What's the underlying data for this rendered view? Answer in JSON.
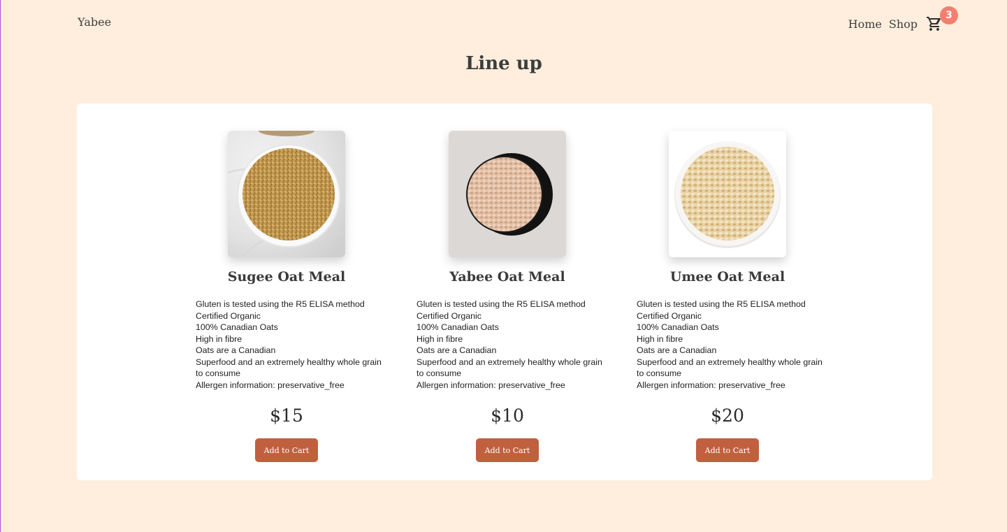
{
  "nav": {
    "brand": "Yabee",
    "links": [
      "Home",
      "Shop"
    ],
    "cart_count": "3"
  },
  "page_title": "Line up",
  "products": [
    {
      "name": "Sugee Oat Meal",
      "description": [
        "Gluten is tested using the R5 ELISA method",
        "Certified Organic",
        "100% Canadian Oats",
        "High in fibre",
        "Oats are a Canadian",
        "Superfood and an extremely healthy whole grain",
        "to consume",
        "Allergen information: preservative_free"
      ],
      "price": "$15",
      "button_label": "Add to Cart",
      "image": "steel-cut-oats-in-bowl"
    },
    {
      "name": "Yabee Oat Meal",
      "description": [
        "Gluten is tested using the R5 ELISA method",
        "Certified Organic",
        "100% Canadian Oats",
        "High in fibre",
        "Oats are a Canadian",
        "Superfood and an extremely healthy whole grain",
        "to consume",
        "Allergen information: preservative_free"
      ],
      "price": "$10",
      "button_label": "Add to Cart",
      "image": "rolled-oats-in-black-bowl"
    },
    {
      "name": "Umee Oat Meal",
      "description": [
        "Gluten is tested using the R5 ELISA method",
        "Certified Organic",
        "100% Canadian Oats",
        "High in fibre",
        "Oats are a Canadian",
        "Superfood and an extremely healthy whole grain",
        "to consume",
        "Allergen information: preservative_free"
      ],
      "price": "$20",
      "button_label": "Add to Cart",
      "image": "rolled-oats-in-white-bowl"
    }
  ],
  "colors": {
    "background": "#ffeedd",
    "panel": "#ffffff",
    "button": "#c0603f",
    "badge": "#f47f6f"
  }
}
